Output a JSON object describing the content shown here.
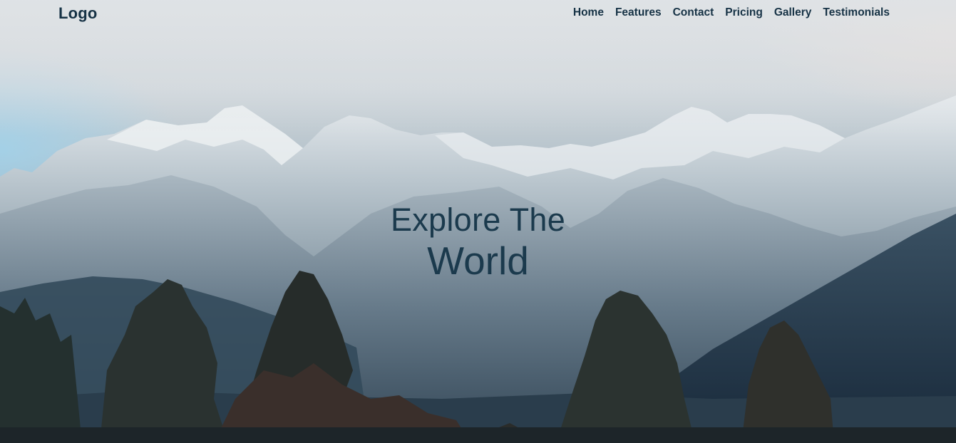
{
  "header": {
    "logo": "Logo",
    "nav": [
      {
        "label": "Home"
      },
      {
        "label": "Features"
      },
      {
        "label": "Contact"
      },
      {
        "label": "Pricing"
      },
      {
        "label": "Gallery"
      },
      {
        "label": "Testimonials"
      }
    ]
  },
  "hero": {
    "line1": "Explore The",
    "line2": "World",
    "background": "snowy-mountains-with-pine-trees-photo"
  },
  "colors": {
    "text": "#163245",
    "hero_text": "#1b3a4d"
  }
}
